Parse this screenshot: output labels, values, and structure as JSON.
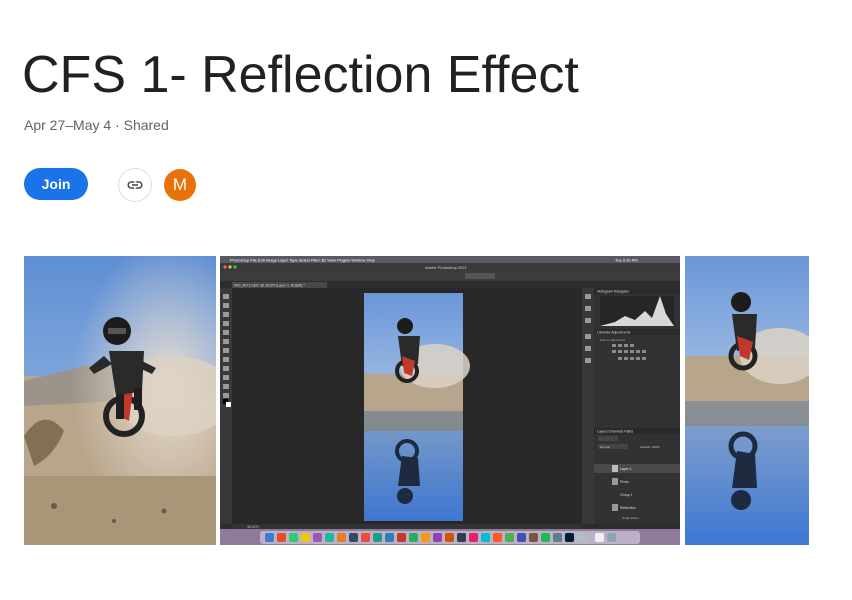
{
  "header": {
    "title": "CFS 1- Reflection Effect",
    "subtitle": "Apr 27–May 4 · Shared"
  },
  "actions": {
    "join_label": "Join",
    "link_icon": "link-icon",
    "avatar_initial": "M",
    "avatar_color": "#e8710a",
    "accent_color": "#1a73e8"
  },
  "photoshop": {
    "menu": [
      "Photoshop",
      "File",
      "Edit",
      "Image",
      "Layer",
      "Type",
      "Select",
      "Filter",
      "3D",
      "View",
      "Plugins",
      "Window",
      "Help"
    ],
    "window_title": "Adobe Photoshop 2021",
    "clock": "Tue 6:30 PM",
    "battery": "77%",
    "doc_tab": "IMG_8971.HEIC @ 36.6% (Layer 1, RGB/8) *",
    "zoom": "36.62%",
    "panel_tabs_top": [
      "Histogram",
      "Navigator"
    ],
    "panel_tabs_mid": [
      "Libraries",
      "Adjustments"
    ],
    "adjust_hint": "Add an adjustment",
    "panel_tabs_layers": [
      "Layers",
      "Channels",
      "Paths"
    ],
    "blend_mode": "Normal",
    "opacity": "Opacity: 100%",
    "layers": [
      "Layer 1",
      "Photo",
      "Group 1",
      "Reflection",
      "Smart Filters"
    ]
  }
}
